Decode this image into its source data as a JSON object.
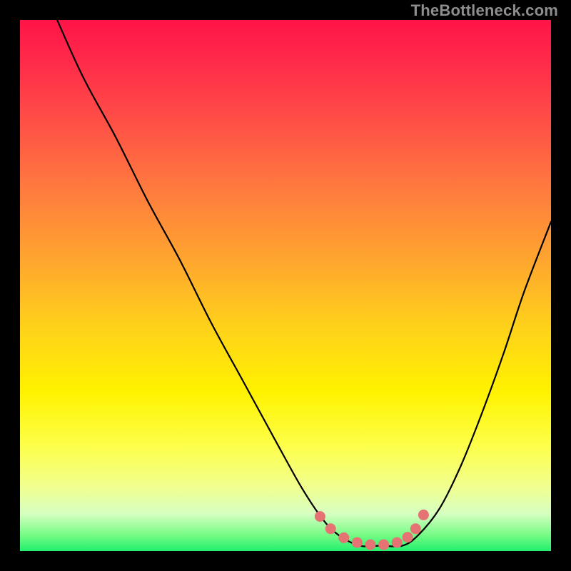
{
  "watermark": "TheBottleneck.com",
  "colors": {
    "curve": "#000000",
    "marker": "#e57373",
    "background": "#000000"
  },
  "chart_data": {
    "type": "line",
    "title": "",
    "xlabel": "",
    "ylabel": "",
    "xlim": [
      0,
      100
    ],
    "ylim": [
      0,
      100
    ],
    "grid": false,
    "series": [
      {
        "name": "curve",
        "x": [
          7,
          12,
          18,
          24,
          30,
          36,
          42,
          48,
          53,
          57,
          60,
          64,
          68,
          72,
          75,
          79,
          83,
          87,
          91,
          95,
          100
        ],
        "y": [
          100,
          89,
          78,
          66,
          55,
          43,
          32,
          21,
          12,
          6,
          3,
          1,
          1,
          1,
          3,
          8,
          16,
          26,
          37,
          49,
          62
        ]
      }
    ],
    "markers": {
      "name": "highlight",
      "x": [
        56.5,
        58.5,
        61,
        63.5,
        66,
        68.5,
        71,
        73,
        74.5,
        76
      ],
      "y": [
        6.5,
        4.2,
        2.5,
        1.6,
        1.2,
        1.2,
        1.6,
        2.6,
        4.2,
        6.8
      ]
    }
  }
}
